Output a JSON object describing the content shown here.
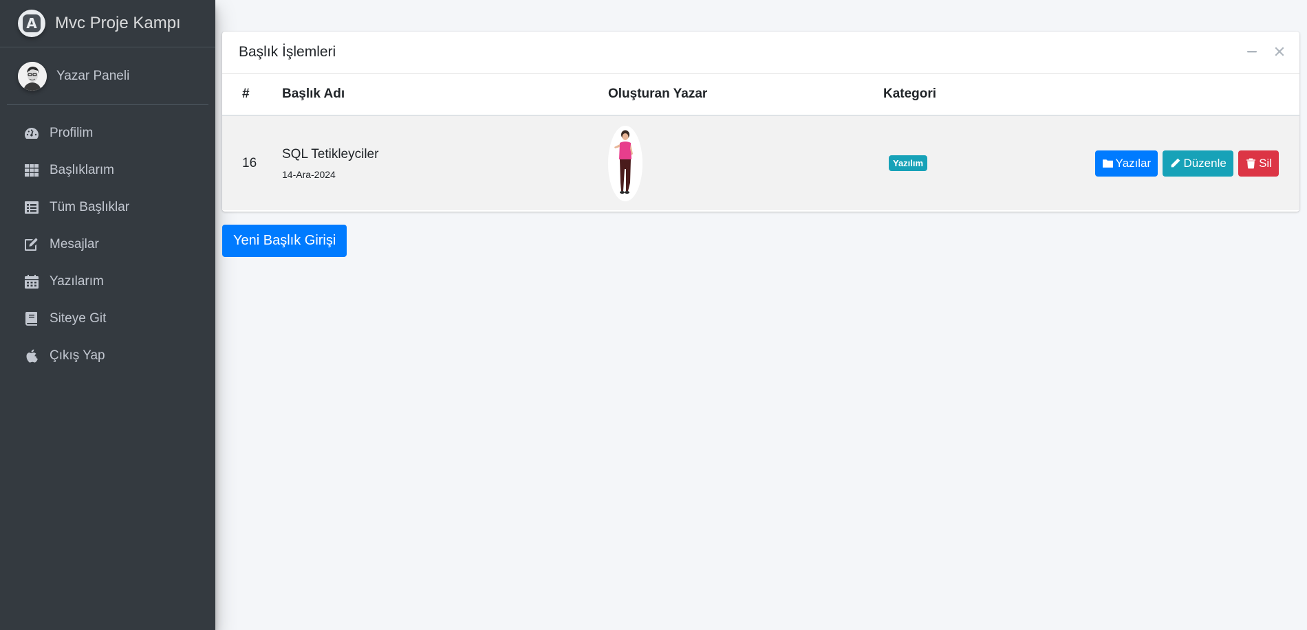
{
  "app": {
    "title": "Mvc Proje Kampı",
    "logo_letter": "A"
  },
  "user": {
    "name": "Yazar Paneli"
  },
  "sidebar": {
    "items": [
      {
        "label": "Profilim",
        "icon": "tachometer-icon"
      },
      {
        "label": "Başlıklarım",
        "icon": "th-icon"
      },
      {
        "label": "Tüm Başlıklar",
        "icon": "list-alt-icon"
      },
      {
        "label": "Mesajlar",
        "icon": "edit-icon"
      },
      {
        "label": "Yazılarım",
        "icon": "calendar-icon"
      },
      {
        "label": "Siteye Git",
        "icon": "book-icon"
      },
      {
        "label": "Çıkış Yap",
        "icon": "apple-icon"
      }
    ]
  },
  "card": {
    "title": "Başlık İşlemleri",
    "columns": [
      "#",
      "Başlık Adı",
      "Oluşturan Yazar",
      "Kategori"
    ],
    "rows": [
      {
        "id": "16",
        "title": "SQL Tetikleyciler",
        "date": "14-Ara-2024",
        "category": "Yazılım",
        "actions": {
          "posts": "Yazılar",
          "edit": "Düzenle",
          "delete": "Sil"
        }
      }
    ]
  },
  "new_button": "Yeni Başlık Girişi",
  "colors": {
    "sidebar": "#343a40",
    "primary": "#007bff",
    "info": "#17a2b8",
    "danger": "#dc3545"
  }
}
